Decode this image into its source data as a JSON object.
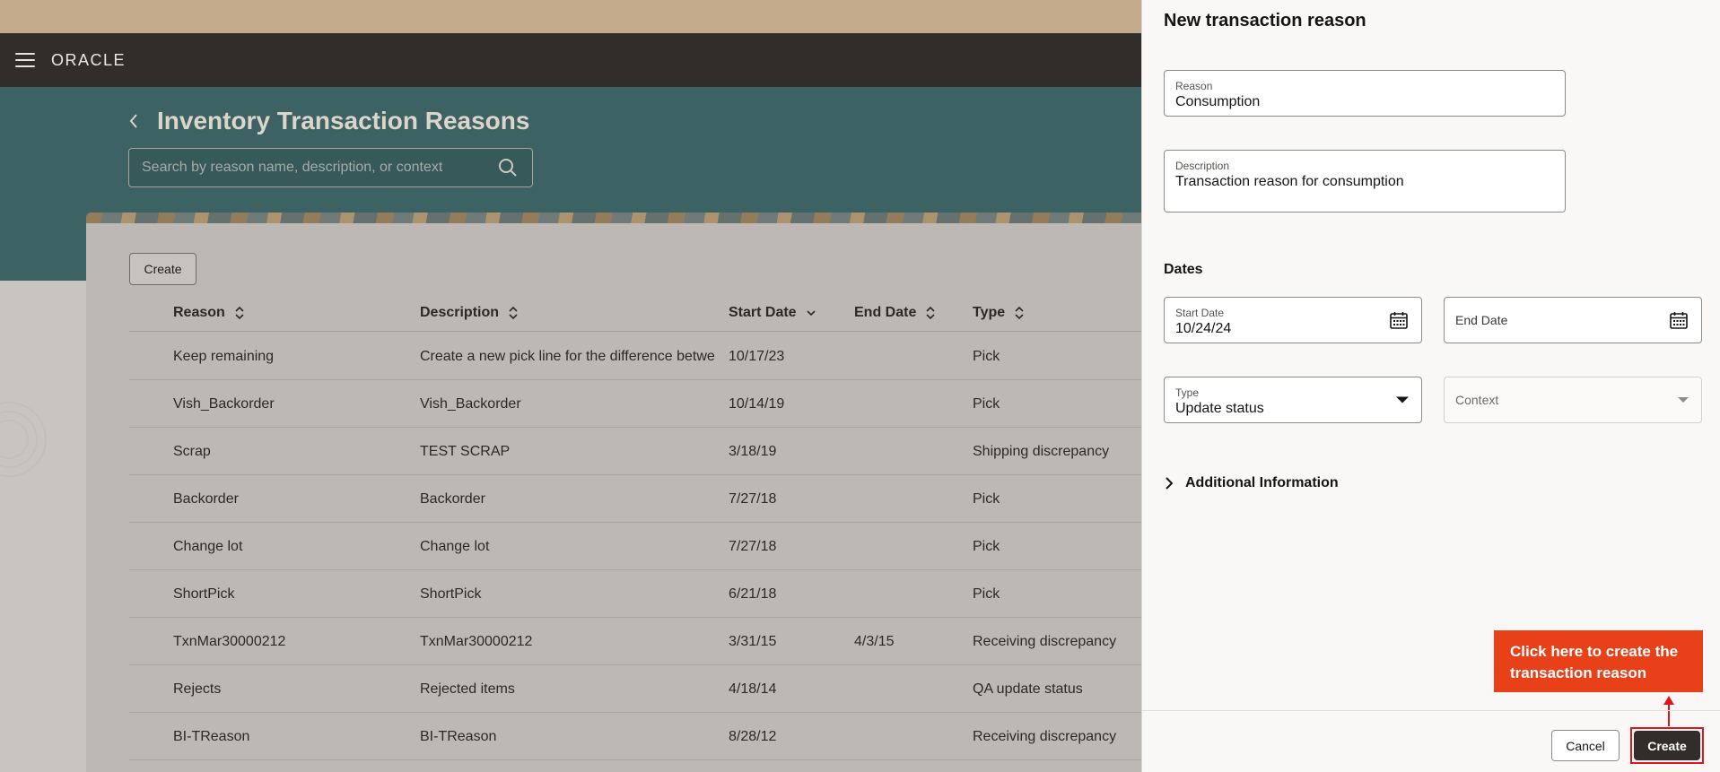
{
  "app": {
    "logo": "ORACLE",
    "menu_icon": "hamburger-menu-icon"
  },
  "page": {
    "title": "Inventory Transaction Reasons",
    "search_placeholder": "Search by reason name, description, or context",
    "create_label": "Create"
  },
  "table": {
    "columns": [
      {
        "label": "Reason",
        "sort": "both"
      },
      {
        "label": "Description",
        "sort": "both"
      },
      {
        "label": "Start Date",
        "sort": "desc"
      },
      {
        "label": "End Date",
        "sort": "both"
      },
      {
        "label": "Type",
        "sort": "both"
      }
    ],
    "rows": [
      {
        "reason": "Keep remaining",
        "description": "Create a new pick line for the difference betwe",
        "start": "10/17/23",
        "end": "",
        "type": "Pick"
      },
      {
        "reason": "Vish_Backorder",
        "description": "Vish_Backorder",
        "start": "10/14/19",
        "end": "",
        "type": "Pick"
      },
      {
        "reason": "Scrap",
        "description": "TEST SCRAP",
        "start": "3/18/19",
        "end": "",
        "type": "Shipping discrepancy"
      },
      {
        "reason": "Backorder",
        "description": "Backorder",
        "start": "7/27/18",
        "end": "",
        "type": "Pick"
      },
      {
        "reason": "Change lot",
        "description": "Change lot",
        "start": "7/27/18",
        "end": "",
        "type": "Pick"
      },
      {
        "reason": "ShortPick",
        "description": "ShortPick",
        "start": "6/21/18",
        "end": "",
        "type": "Pick"
      },
      {
        "reason": "TxnMar30000212",
        "description": "TxnMar30000212",
        "start": "3/31/15",
        "end": "4/3/15",
        "type": "Receiving discrepancy"
      },
      {
        "reason": "Rejects",
        "description": "Rejected items",
        "start": "4/18/14",
        "end": "",
        "type": "QA update status"
      },
      {
        "reason": "BI-TReason",
        "description": "BI-TReason",
        "start": "8/28/12",
        "end": "",
        "type": "Receiving discrepancy"
      }
    ]
  },
  "drawer": {
    "title": "New transaction reason",
    "reason_label": "Reason",
    "reason_value": "Consumption",
    "description_label": "Description",
    "description_value": "Transaction reason for consumption",
    "dates_heading": "Dates",
    "start_date_label": "Start Date",
    "start_date_value": "10/24/24",
    "end_date_label": "End Date",
    "type_label": "Type",
    "type_value": "Update status",
    "context_label": "Context",
    "additional_info": "Additional Information",
    "cancel_label": "Cancel",
    "create_label": "Create"
  },
  "callout": {
    "text": "Click here to create the transaction reason",
    "color": "#e8411a"
  }
}
